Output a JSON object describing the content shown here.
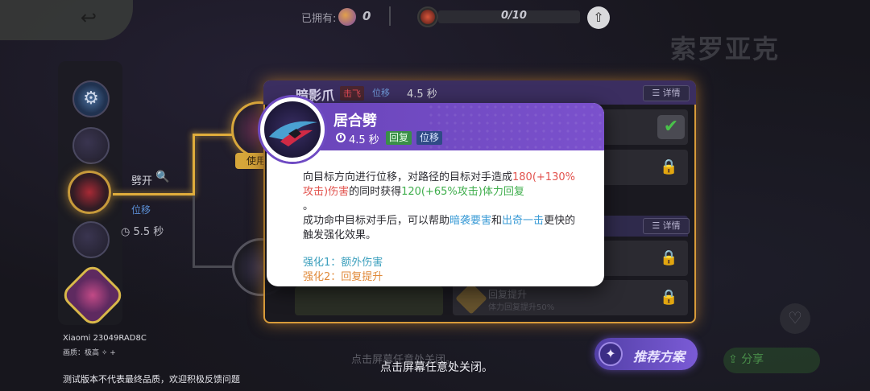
{
  "top_bar": {
    "owned_label": "已拥有:",
    "owned_count": "0",
    "progress_text": "0/10"
  },
  "pokemon_name": "索罗亚克",
  "left_panel": {
    "selected_move_name": "劈开",
    "selected_move_tag": "位移",
    "selected_move_cooldown": "5.5 秒"
  },
  "use_tag": "使用",
  "background_skill": {
    "name": "暗影爪",
    "tag_knockup": "击飞",
    "tag_move": "位移",
    "cooldown": "4.5 秒",
    "detail_label": "详情",
    "detail_label_2": "详情",
    "item_title": "回复提升",
    "item_desc": "体力回复提升50%"
  },
  "popup": {
    "title": "居合劈",
    "cooldown": "4.5 秒",
    "tags": [
      "回复",
      "位移"
    ],
    "desc_p1_a": "向目标方向进行位移，对路径的目标对手造成",
    "desc_p1_dmg": "180(+130%攻击)伤害",
    "desc_p1_b": "的同时获得",
    "desc_p1_heal": "120(+65%攻击)体力回复",
    "desc_p1_end": "。",
    "desc_p2_a": "成功命中目标对手后，可以帮助",
    "desc_p2_link1": "暗袭要害",
    "desc_p2_and": "和",
    "desc_p2_link2": "出奇一击",
    "desc_p2_b": "更快的触发强化效果。",
    "enhance_1": "强化1：额外伤害",
    "enhance_2": "强化2：回复提升"
  },
  "buttons": {
    "recommend": "推荐方案",
    "share": "分享",
    "bg_close_hint": "点击屏幕任意处关闭。"
  },
  "close_hint": "点击屏幕任意处关闭。",
  "device": {
    "name": "Xiaomi 23049RAD8C",
    "quality": "画质：极高 ✧ +"
  },
  "test_notice": "测试版本不代表最终品质，欢迎积极反馈问题",
  "colors": {
    "popup_header": "#7b51cd",
    "highlight_orange": "#d89b3a",
    "damage_red": "#e2534e",
    "heal_green": "#3fae4c",
    "link_blue": "#3a9bd6"
  },
  "icons": [
    "back-arrow-icon",
    "owned-icon",
    "progress-icon",
    "upgrade-icon",
    "magnify-icon",
    "clock-icon",
    "lock-icon",
    "check-icon",
    "recommend-icon",
    "heart-icon",
    "skill-icon"
  ]
}
